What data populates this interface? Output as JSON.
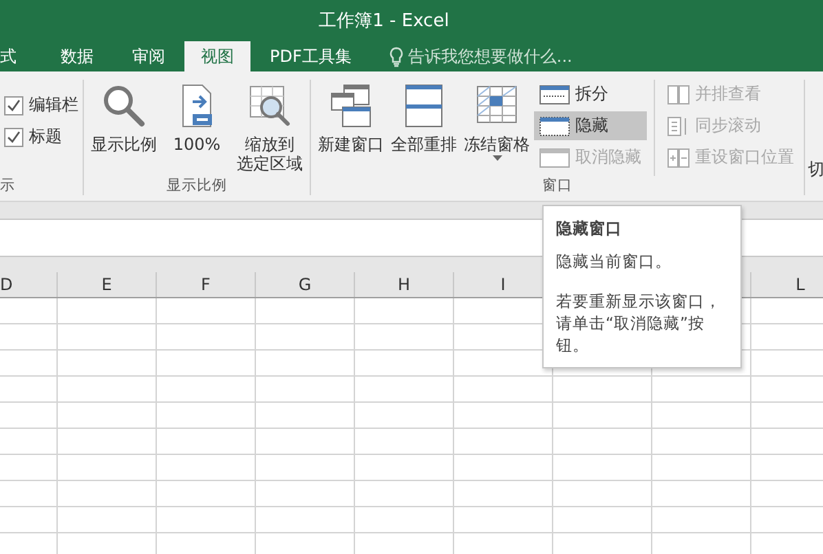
{
  "window": {
    "title": "工作簿1 - Excel"
  },
  "tabs": [
    {
      "label": "式",
      "selected": false
    },
    {
      "label": "数据",
      "selected": false
    },
    {
      "label": "审阅",
      "selected": false
    },
    {
      "label": "视图",
      "selected": true
    },
    {
      "label": "PDF工具集",
      "selected": false
    }
  ],
  "tell_me": {
    "placeholder": "告诉我您想要做什么..."
  },
  "ribbon": {
    "groups": [
      {
        "label": "示",
        "items": [
          {
            "kind": "checkbox",
            "label": "编辑栏",
            "checked": true
          },
          {
            "kind": "checkbox",
            "label": "标题",
            "checked": true
          }
        ]
      },
      {
        "label": "显示比例",
        "items": [
          {
            "kind": "large",
            "label": "显示比例"
          },
          {
            "kind": "large",
            "label": "100%"
          },
          {
            "kind": "large",
            "label_lines": [
              "缩放到",
              "选定区域"
            ]
          }
        ]
      },
      {
        "label": "窗口",
        "items": [
          {
            "kind": "large",
            "label": "新建窗口"
          },
          {
            "kind": "large",
            "label": "全部重排"
          },
          {
            "kind": "large",
            "label": "冻结窗格",
            "dropdown": true
          },
          {
            "kind": "small",
            "label": "拆分",
            "highlighted": false,
            "disabled": false
          },
          {
            "kind": "small",
            "label": "隐藏",
            "highlighted": true,
            "disabled": false
          },
          {
            "kind": "small",
            "label": "取消隐藏",
            "highlighted": false,
            "disabled": true
          },
          {
            "kind": "small",
            "label": "并排查看",
            "highlighted": false,
            "disabled": true
          },
          {
            "kind": "small",
            "label": "同步滚动",
            "highlighted": false,
            "disabled": true
          },
          {
            "kind": "small",
            "label": "重设窗口位置",
            "highlighted": false,
            "disabled": true
          }
        ]
      },
      {
        "items": [
          {
            "kind": "large",
            "label": "切"
          }
        ]
      }
    ]
  },
  "grid": {
    "columns_left": [
      "D",
      "E",
      "F",
      "G",
      "H",
      "I"
    ],
    "columns_right": [
      "L"
    ]
  },
  "tooltip": {
    "title": "隐藏窗口",
    "paragraphs": [
      "隐藏当前窗口。",
      "若要重新显示该窗口，请单击“取消隐藏”按钮。"
    ]
  }
}
